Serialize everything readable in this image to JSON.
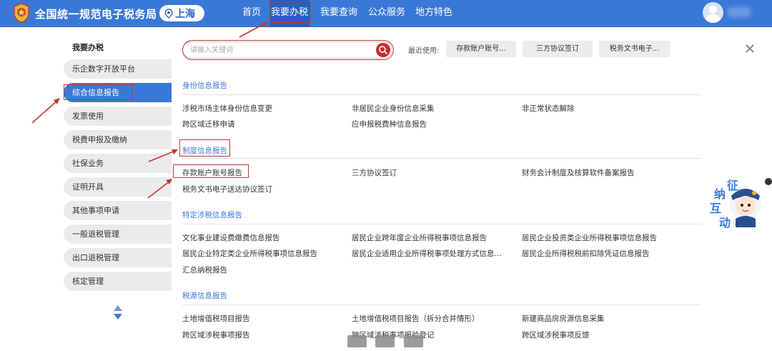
{
  "header": {
    "site_title": "全国统一规范电子税务局",
    "location": "上海",
    "nav": [
      {
        "label": "首页",
        "active": false
      },
      {
        "label": "我要办税",
        "active": true
      },
      {
        "label": "我要查询",
        "active": false
      },
      {
        "label": "公众服务",
        "active": false
      },
      {
        "label": "地方特色",
        "active": false
      }
    ],
    "brand_color": "#3a78d8"
  },
  "sidebar": {
    "title": "我要办税",
    "items": [
      {
        "label": "乐企数字开放平台",
        "active": false
      },
      {
        "label": "综合信息报告",
        "active": true
      },
      {
        "label": "发票使用",
        "active": false
      },
      {
        "label": "税费申报及缴纳",
        "active": false
      },
      {
        "label": "社保业务",
        "active": false
      },
      {
        "label": "证明开具",
        "active": false
      },
      {
        "label": "其他事项申请",
        "active": false
      },
      {
        "label": "一般退税管理",
        "active": false
      },
      {
        "label": "出口退税管理",
        "active": false
      },
      {
        "label": "核定管理",
        "active": false
      }
    ]
  },
  "search": {
    "placeholder": "请输入关键词",
    "recent_label": "最近使用:",
    "recent": [
      "存款账户账号...",
      "三方协议签订",
      "税务文书电子..."
    ]
  },
  "sections": [
    {
      "title": "身份信息报告",
      "links": [
        "涉税市场主体身份信息变更",
        "非居民企业身份信息采集",
        "非正常状态解除",
        "跨区域迁移申请",
        "应申报税费种信息报告"
      ]
    },
    {
      "title": "制度信息报告",
      "links": [
        "存款账户账号报告",
        "三方协议签订",
        "财务会计制度及核算软件备案报告",
        "税务文书电子送达协议签订"
      ]
    },
    {
      "title": "特定涉税信息报告",
      "links": [
        "文化事业建设费缴费信息报告",
        "居民企业跨年度企业所得税事项信息报告",
        "居民企业投资类企业所得税事项信息报告",
        "居民企业特定类企业所得税事项信息报告",
        "居民企业适用企业所得税事项处理方式信息...",
        "居民企业所得税税前扣除凭证信息报告",
        "汇总纳税报告"
      ]
    },
    {
      "title": "税源信息报告",
      "links": [
        "土地增值税项目报告",
        "土地增值税项目报告（拆分合并情形）",
        "新建商品房房源信息采集",
        "跨区域涉税事项报告",
        "跨区域涉税事项报验登记",
        "跨区域涉税事项反馈"
      ]
    }
  ],
  "mascot": {
    "text": [
      "征",
      "纳",
      "互",
      "动"
    ]
  },
  "annotation_color": "#c0392b"
}
